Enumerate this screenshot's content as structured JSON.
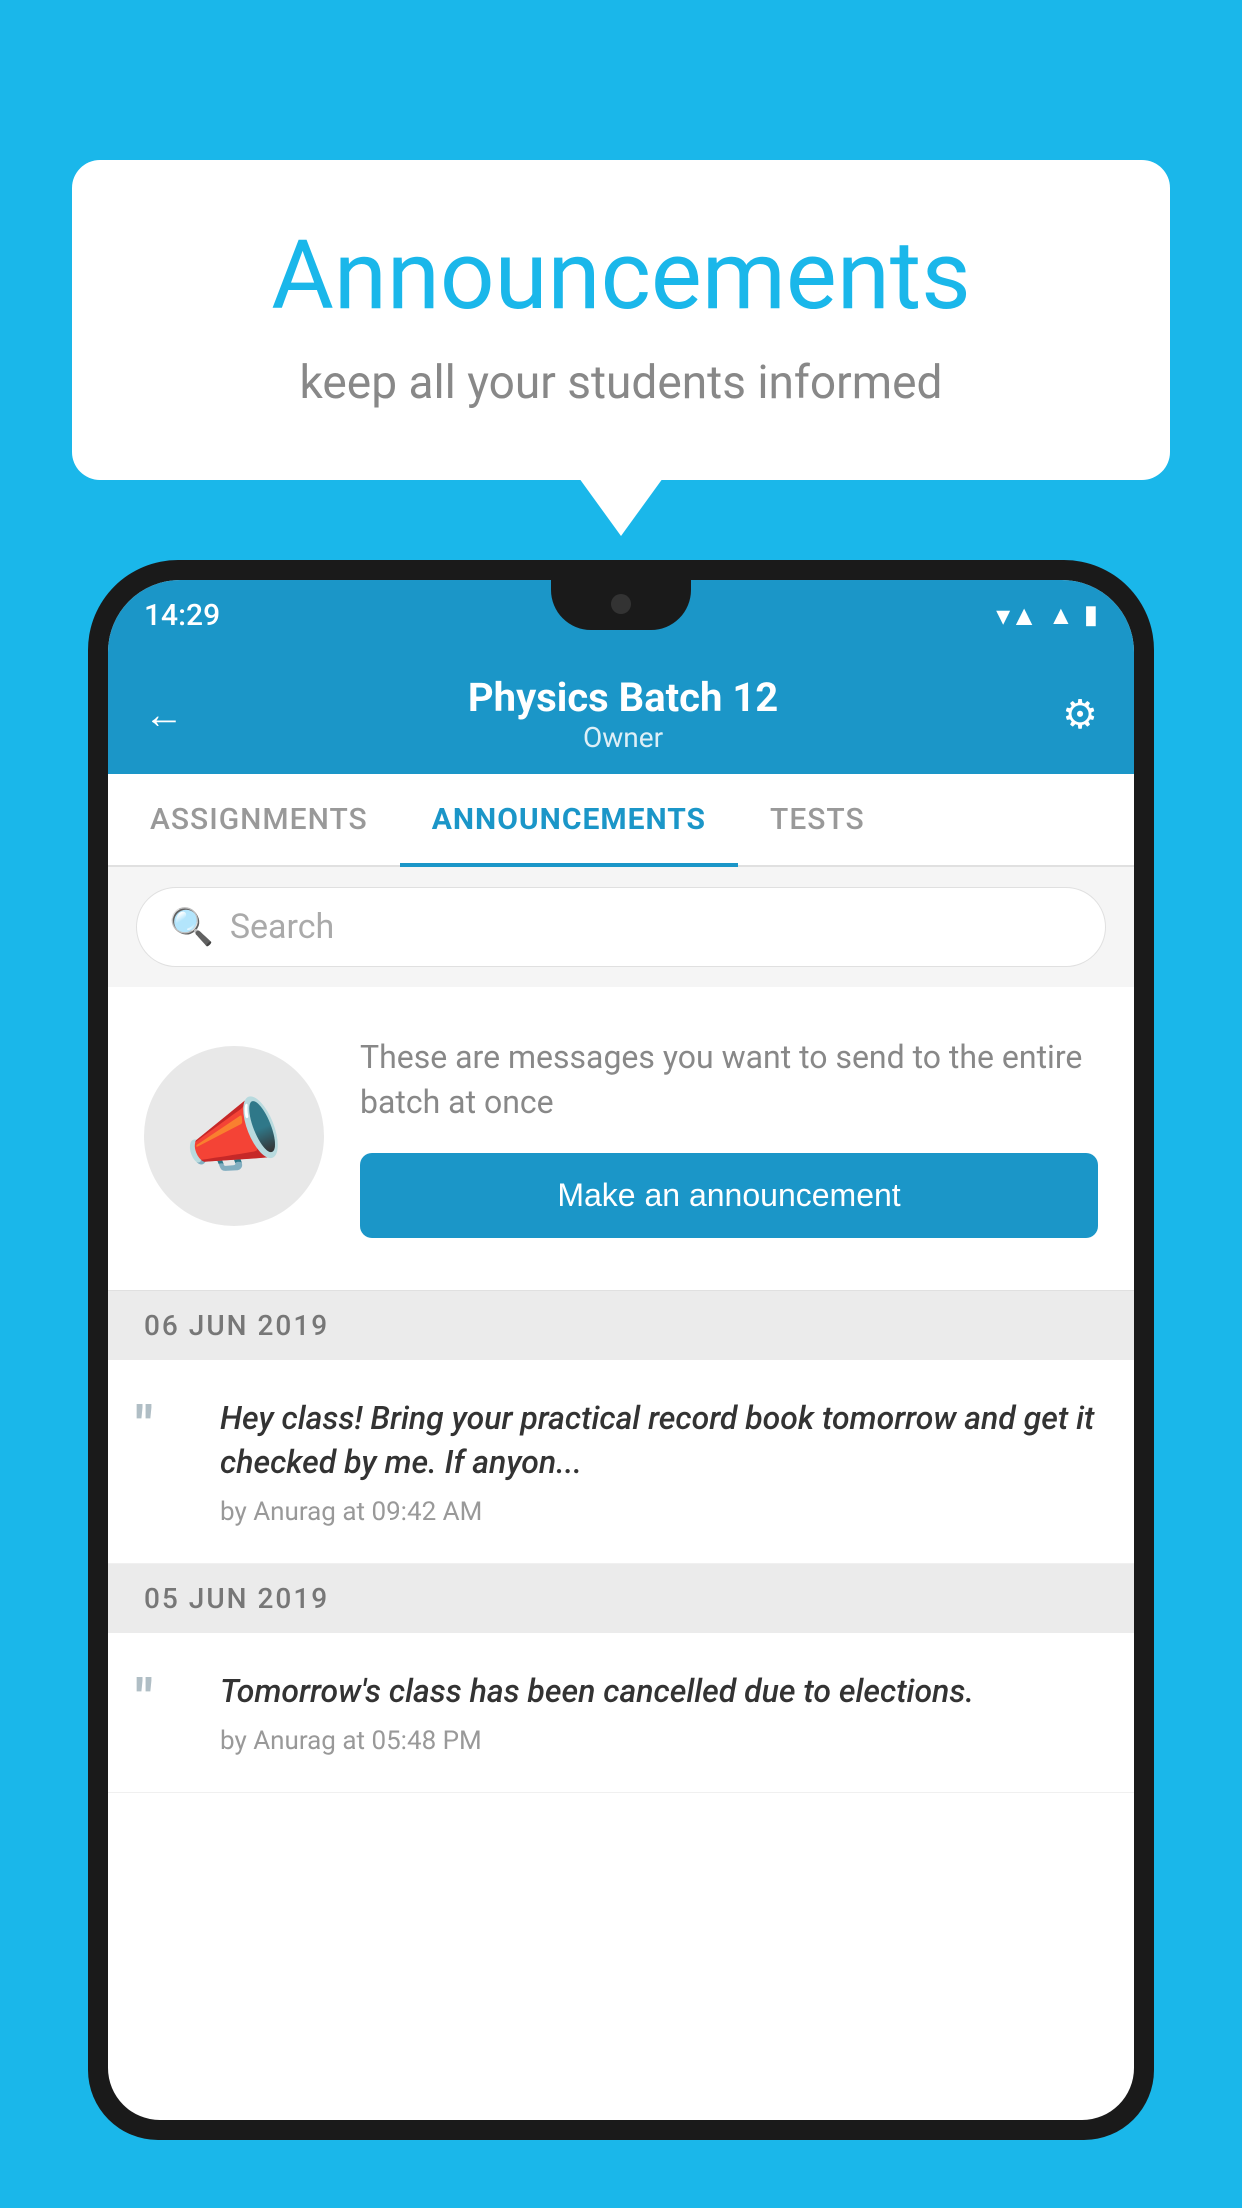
{
  "background_color": "#1ab7ea",
  "speech_bubble": {
    "title": "Announcements",
    "subtitle": "keep all your students informed"
  },
  "phone": {
    "status_bar": {
      "time": "14:29"
    },
    "header": {
      "back_label": "←",
      "title": "Physics Batch 12",
      "subtitle": "Owner",
      "settings_label": "⚙"
    },
    "tabs": [
      {
        "label": "ASSIGNMENTS",
        "active": false
      },
      {
        "label": "ANNOUNCEMENTS",
        "active": true
      },
      {
        "label": "TESTS",
        "active": false
      }
    ],
    "search": {
      "placeholder": "Search"
    },
    "announcement_prompt": {
      "description_text": "These are messages you want to send to the entire batch at once",
      "button_label": "Make an announcement"
    },
    "announcements": [
      {
        "date": "06  JUN  2019",
        "items": [
          {
            "text": "Hey class! Bring your practical record book tomorrow and get it checked by me. If anyon...",
            "meta": "by Anurag at 09:42 AM"
          }
        ]
      },
      {
        "date": "05  JUN  2019",
        "items": [
          {
            "text": "Tomorrow's class has been cancelled due to elections.",
            "meta": "by Anurag at 05:48 PM"
          }
        ]
      }
    ]
  }
}
